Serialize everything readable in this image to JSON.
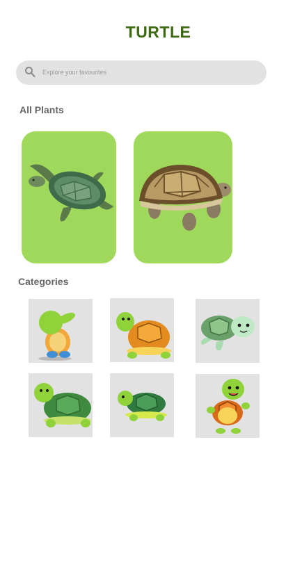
{
  "app": {
    "title": "TURTLE"
  },
  "search": {
    "placeholder": "Explore your favourites",
    "icon": "search-icon"
  },
  "plants": {
    "title": "All Plants",
    "items": [
      {
        "image": "sea-turtle-image"
      },
      {
        "image": "tortoise-image"
      }
    ]
  },
  "categories": {
    "title": "Categories",
    "items": [
      {
        "image": "cartoon-turtle-dab-image"
      },
      {
        "image": "cartoon-turtle-orange-shell-image"
      },
      {
        "image": "cartoon-sea-turtle-image"
      },
      {
        "image": "cartoon-turtle-green-shell-image"
      },
      {
        "image": "cartoon-turtle-walking-image"
      },
      {
        "image": "cartoon-turtle-waving-image"
      }
    ]
  },
  "colors": {
    "title": "#3c6b12",
    "card_bg": "#9fd85a",
    "tile_bg": "#e2e2e2",
    "search_bg": "#e2e2e2"
  }
}
